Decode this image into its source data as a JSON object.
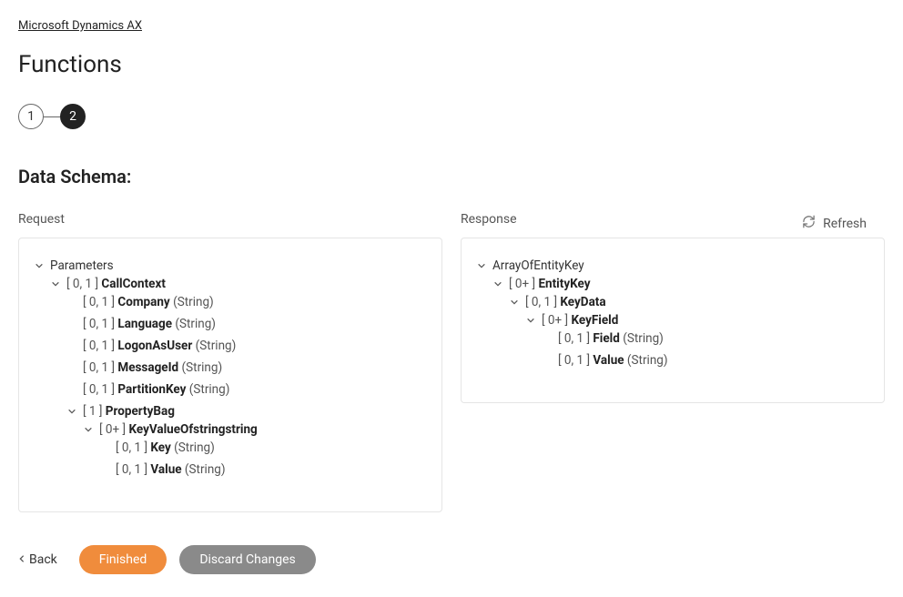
{
  "breadcrumb": "Microsoft Dynamics AX",
  "page_title": "Functions",
  "steps": [
    "1",
    "2"
  ],
  "active_step_index": 1,
  "section_title": "Data Schema:",
  "refresh_label": "Refresh",
  "request_label": "Request",
  "response_label": "Response",
  "back_label": "Back",
  "finished_label": "Finished",
  "discard_label": "Discard Changes",
  "request_tree": [
    {
      "expandable": true,
      "cardinality": "",
      "name": "Parameters",
      "name_bold": false,
      "type": "",
      "children": [
        {
          "expandable": true,
          "cardinality": "[ 0, 1 ]",
          "name": "CallContext",
          "name_bold": true,
          "type": "",
          "children": [
            {
              "expandable": false,
              "cardinality": "[ 0, 1 ]",
              "name": "Company",
              "name_bold": true,
              "type": "(String)"
            },
            {
              "expandable": false,
              "cardinality": "[ 0, 1 ]",
              "name": "Language",
              "name_bold": true,
              "type": "(String)"
            },
            {
              "expandable": false,
              "cardinality": "[ 0, 1 ]",
              "name": "LogonAsUser",
              "name_bold": true,
              "type": "(String)"
            },
            {
              "expandable": false,
              "cardinality": "[ 0, 1 ]",
              "name": "MessageId",
              "name_bold": true,
              "type": "(String)"
            },
            {
              "expandable": false,
              "cardinality": "[ 0, 1 ]",
              "name": "PartitionKey",
              "name_bold": true,
              "type": "(String)"
            },
            {
              "expandable": true,
              "cardinality": "[ 1 ]",
              "name": "PropertyBag",
              "name_bold": true,
              "type": "",
              "children": [
                {
                  "expandable": true,
                  "cardinality": "[ 0+ ]",
                  "name": "KeyValueOfstringstring",
                  "name_bold": true,
                  "type": "",
                  "children": [
                    {
                      "expandable": false,
                      "cardinality": "[ 0, 1 ]",
                      "name": "Key",
                      "name_bold": true,
                      "type": "(String)"
                    },
                    {
                      "expandable": false,
                      "cardinality": "[ 0, 1 ]",
                      "name": "Value",
                      "name_bold": true,
                      "type": "(String)"
                    }
                  ]
                }
              ]
            }
          ]
        }
      ]
    }
  ],
  "response_tree": [
    {
      "expandable": true,
      "cardinality": "",
      "name": "ArrayOfEntityKey",
      "name_bold": false,
      "type": "",
      "children": [
        {
          "expandable": true,
          "cardinality": "[ 0+ ]",
          "name": "EntityKey",
          "name_bold": true,
          "type": "",
          "children": [
            {
              "expandable": true,
              "cardinality": "[ 0, 1 ]",
              "name": "KeyData",
              "name_bold": true,
              "type": "",
              "children": [
                {
                  "expandable": true,
                  "cardinality": "[ 0+ ]",
                  "name": "KeyField",
                  "name_bold": true,
                  "type": "",
                  "children": [
                    {
                      "expandable": false,
                      "cardinality": "[ 0, 1 ]",
                      "name": "Field",
                      "name_bold": true,
                      "type": "(String)"
                    },
                    {
                      "expandable": false,
                      "cardinality": "[ 0, 1 ]",
                      "name": "Value",
                      "name_bold": true,
                      "type": "(String)"
                    }
                  ]
                }
              ]
            }
          ]
        }
      ]
    }
  ]
}
